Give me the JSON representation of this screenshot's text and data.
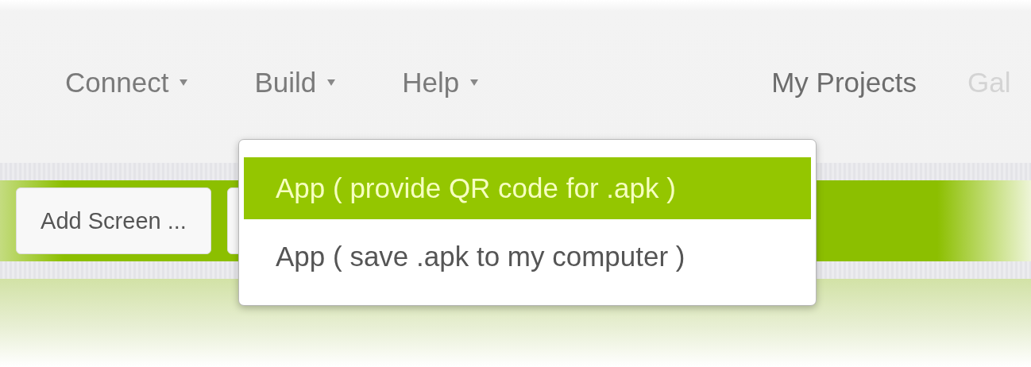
{
  "top_menu": [
    {
      "label": "Connect",
      "has_menu": true
    },
    {
      "label": "Build",
      "has_menu": true
    },
    {
      "label": "Help",
      "has_menu": true
    }
  ],
  "right_links": [
    {
      "label": "My Projects"
    },
    {
      "label": "Gal"
    }
  ],
  "toolbar": {
    "buttons": [
      {
        "kind": "text",
        "label": "Add Screen ..."
      },
      {
        "kind": "hidden"
      }
    ]
  },
  "dropdown": {
    "items": [
      {
        "label": "App ( provide QR code for .apk )",
        "selected": true
      },
      {
        "label": "App ( save .apk to my computer )",
        "selected": false
      }
    ]
  }
}
